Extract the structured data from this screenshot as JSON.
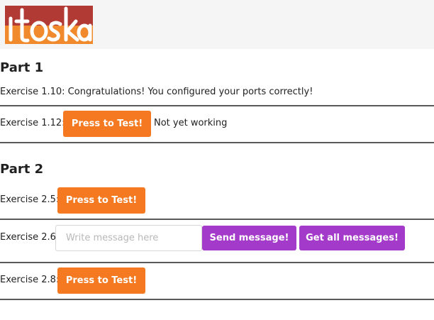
{
  "brand": {
    "logo_text": "itoska",
    "colors": {
      "header_bg": "#f5f5f5",
      "logo_red": "#b23a35",
      "logo_orange": "#f08a2c",
      "button_orange": "#f47920",
      "button_purple": "#a43ac9"
    }
  },
  "part1": {
    "title": "Part 1",
    "ex110_text": "Exercise 1.10: Congratulations! You configured your ports correctly!",
    "ex112_label": "Exercise 1.12:",
    "ex112_button": "Press to Test!",
    "ex112_status": "Not yet working"
  },
  "part2": {
    "title": "Part 2",
    "ex25_label": "Exercise 2.5:",
    "ex25_button": "Press to Test!",
    "ex26_label": "Exercise 2.6:",
    "ex26_placeholder": "Write message here",
    "ex26_send_button": "Send message!",
    "ex26_get_button": "Get all messages!",
    "ex28_label": "Exercise 2.8:",
    "ex28_button": "Press to Test!"
  }
}
